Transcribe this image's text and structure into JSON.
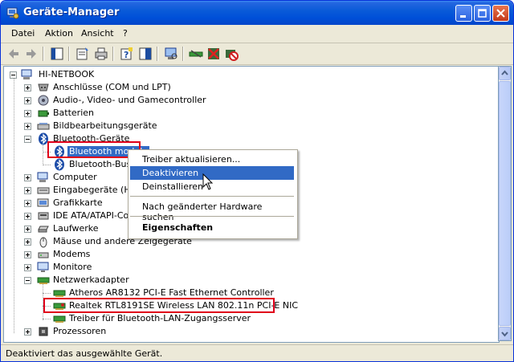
{
  "window": {
    "title": "Geräte-Manager"
  },
  "menubar": {
    "items": [
      "Datei",
      "Aktion",
      "Ansicht",
      "?"
    ]
  },
  "toolbar": {
    "icons": [
      "back-icon",
      "forward-icon",
      "console-tree-icon",
      "properties-icon",
      "print-icon",
      "help-icon",
      "show-hide-icon",
      "scan-hardware-icon",
      "update-driver-icon",
      "uninstall-icon",
      "disable-icon"
    ]
  },
  "tree": {
    "root": "HI-NETBOOK",
    "categories": [
      {
        "label": "Anschlüsse (COM und LPT)",
        "expanded": false
      },
      {
        "label": "Audio-, Video- und Gamecontroller",
        "expanded": false
      },
      {
        "label": "Batterien",
        "expanded": false
      },
      {
        "label": "Bildbearbeitungsgeräte",
        "expanded": false
      },
      {
        "label": "Bluetooth-Geräte",
        "expanded": true
      },
      {
        "label": "Bluetooth module",
        "child": true,
        "selected": true
      },
      {
        "label": "Bluetooth-Bus-E",
        "child": true
      },
      {
        "label": "Computer",
        "expanded": false
      },
      {
        "label": "Eingabegeräte (Hur",
        "expanded": false
      },
      {
        "label": "Grafikkarte",
        "expanded": false
      },
      {
        "label": "IDE ATA/ATAPI-Con",
        "expanded": false
      },
      {
        "label": "Laufwerke",
        "expanded": false
      },
      {
        "label": "Mäuse und andere Zeigegeräte",
        "expanded": false
      },
      {
        "label": "Modems",
        "expanded": false
      },
      {
        "label": "Monitore",
        "expanded": false
      },
      {
        "label": "Netzwerkadapter",
        "expanded": true
      },
      {
        "label": "Atheros AR8132 PCI-E Fast Ethernet Controller",
        "child": true
      },
      {
        "label": "Realtek RTL8191SE Wireless LAN 802.11n PCI-E NIC",
        "child": true
      },
      {
        "label": "Treiber für Bluetooth-LAN-Zugangsserver",
        "child": true
      },
      {
        "label": "Prozessoren",
        "expanded": false
      }
    ]
  },
  "context_menu": {
    "items": [
      {
        "label": "Treiber aktualisieren..."
      },
      {
        "label": "Deaktivieren",
        "highlighted": true
      },
      {
        "label": "Deinstallieren"
      },
      {
        "label": "Nach geänderter Hardware suchen"
      },
      {
        "label": "Eigenschaften",
        "bold": true
      }
    ]
  },
  "statusbar": {
    "text": "Deaktiviert das ausgewählte Gerät."
  },
  "colors": {
    "selection": "#316ac5",
    "highlight_box": "#e0001a",
    "titlebar": "#0a5bd8"
  }
}
